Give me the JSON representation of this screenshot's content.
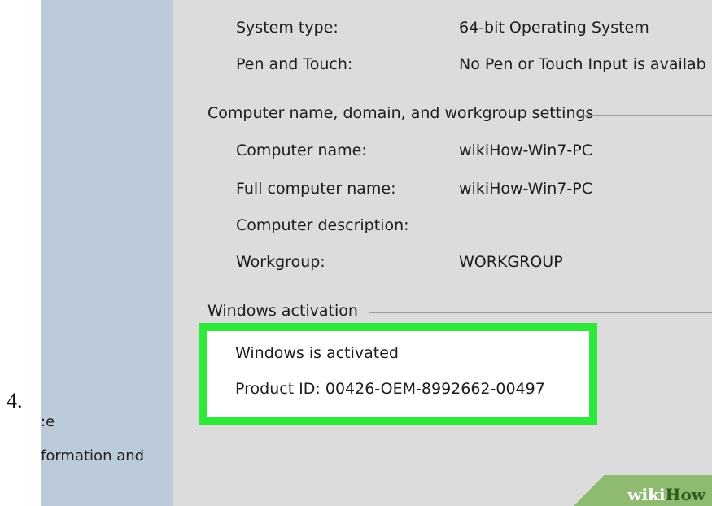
{
  "step_number": "4.",
  "sidebar": {
    "line1": ":e",
    "line2": "formation and"
  },
  "system": {
    "rows": [
      {
        "label": "System type:",
        "value": "64-bit Operating System"
      },
      {
        "label": "Pen and Touch:",
        "value": "No Pen or Touch Input is availab"
      }
    ]
  },
  "computer_name": {
    "title": "Computer name, domain, and workgroup settings",
    "rows": [
      {
        "label": "Computer name:",
        "value": "wikiHow-Win7-PC"
      },
      {
        "label": "Full computer name:",
        "value": "wikiHow-Win7-PC"
      },
      {
        "label": "Computer description:",
        "value": ""
      },
      {
        "label": "Workgroup:",
        "value": "WORKGROUP"
      }
    ]
  },
  "activation": {
    "title": "Windows activation",
    "status": "Windows is activated",
    "product_id": "Product ID: 00426-OEM-8992662-00497"
  },
  "watermark": {
    "part1": "wiki",
    "part2": "How"
  },
  "colors": {
    "highlight_border": "#2ee83a",
    "sidebar_bg": "#bccbda",
    "panel_bg": "#dcdcdc"
  }
}
